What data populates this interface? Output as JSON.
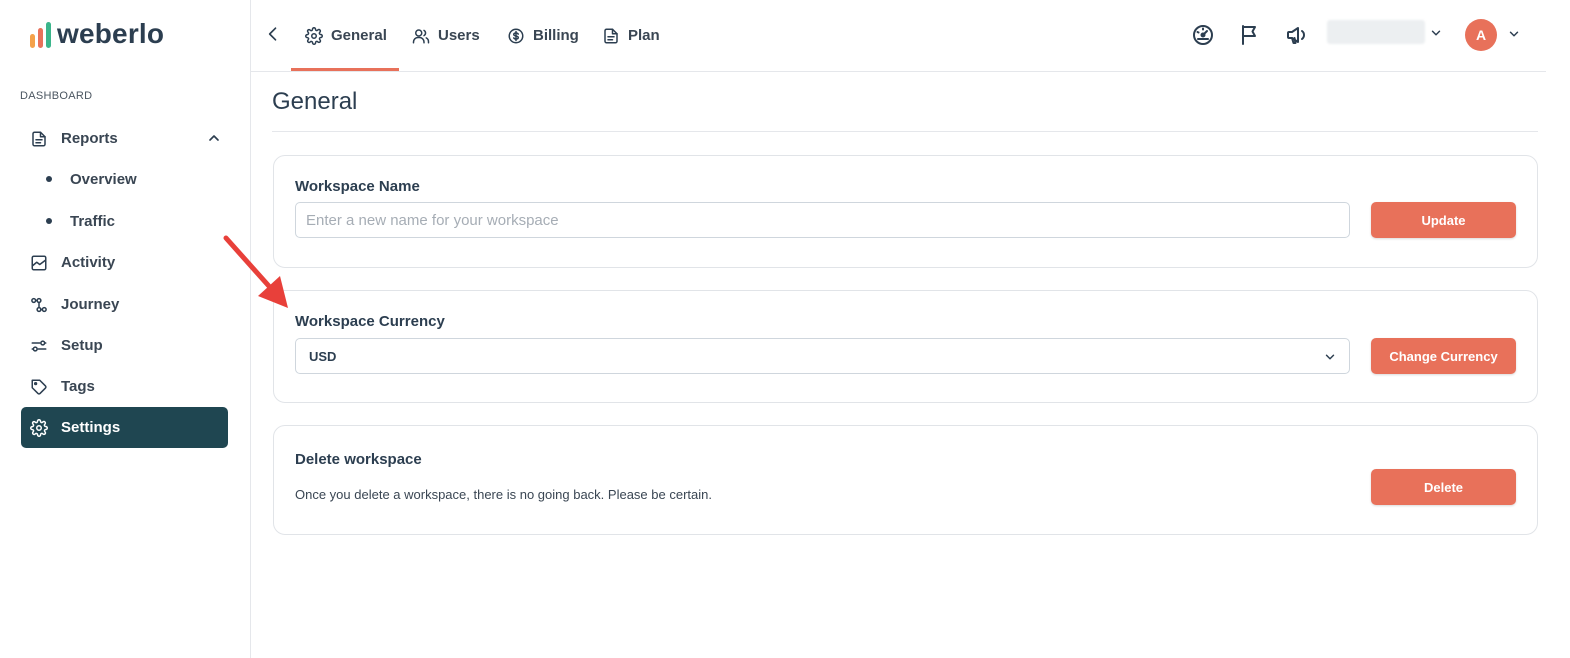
{
  "brand": {
    "name": "weberlo",
    "accent_color": "#e8715a",
    "sidebar_active_color": "#1f4651",
    "logo_bar_colors": [
      "#f4a14a",
      "#e8715a",
      "#3bb58b"
    ]
  },
  "sidebar": {
    "section_label": "DASHBOARD",
    "items": [
      {
        "label": "Reports",
        "icon": "document-icon",
        "expanded": true
      },
      {
        "label": "Activity",
        "icon": "chart-window-icon"
      },
      {
        "label": "Journey",
        "icon": "journey-nodes-icon"
      },
      {
        "label": "Setup",
        "icon": "sliders-icon"
      },
      {
        "label": "Tags",
        "icon": "tag-icon"
      },
      {
        "label": "Settings",
        "icon": "gear-icon",
        "active": true
      }
    ],
    "sub_items": [
      {
        "label": "Overview"
      },
      {
        "label": "Traffic"
      }
    ]
  },
  "topbar": {
    "tabs": [
      {
        "label": "General",
        "icon": "gear-icon",
        "active": true
      },
      {
        "label": "Users",
        "icon": "users-icon"
      },
      {
        "label": "Billing",
        "icon": "dollar-circle-icon"
      },
      {
        "label": "Plan",
        "icon": "document-icon"
      }
    ],
    "icons": [
      "gauge-icon",
      "flag-icon",
      "megaphone-icon"
    ],
    "avatar_initial": "A"
  },
  "main": {
    "title": "General",
    "workspace_name": {
      "label": "Workspace Name",
      "placeholder": "Enter a new name for your workspace",
      "value": "",
      "button": "Update"
    },
    "workspace_currency": {
      "label": "Workspace Currency",
      "selected": "USD",
      "button": "Change Currency"
    },
    "delete_workspace": {
      "label": "Delete workspace",
      "description": "Once you delete a workspace, there is no going back. Please be certain.",
      "button": "Delete"
    }
  }
}
